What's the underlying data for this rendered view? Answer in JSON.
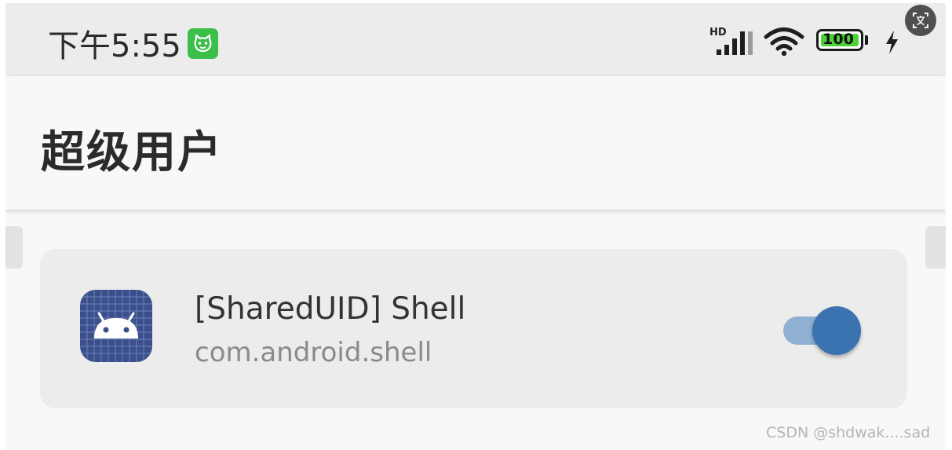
{
  "status_bar": {
    "time": "下午5:55",
    "notification_icon": "app-cat-icon",
    "network_label": "HD",
    "signal_icon": "cell-signal-icon",
    "wifi_icon": "wifi-icon",
    "battery_level": "100",
    "battery_fraction": 1.0,
    "charging_icon": "charging-bolt-icon",
    "translate_icon": "translate-icon",
    "colors": {
      "background": "#ececec",
      "notification_badge": "#3bbf4a",
      "battery_fill": "#4cd137"
    }
  },
  "app_bar": {
    "title": "超级用户"
  },
  "apps": [
    {
      "name": "[SharedUID] Shell",
      "package": "com.android.shell",
      "icon": "android-icon",
      "enabled": true
    }
  ],
  "colors": {
    "accent": "#3b72b0",
    "accent_track": "#8fb0d2",
    "card": "#ececec",
    "page": "#f8f8f8"
  },
  "watermark": "CSDN @shdwak....sad"
}
